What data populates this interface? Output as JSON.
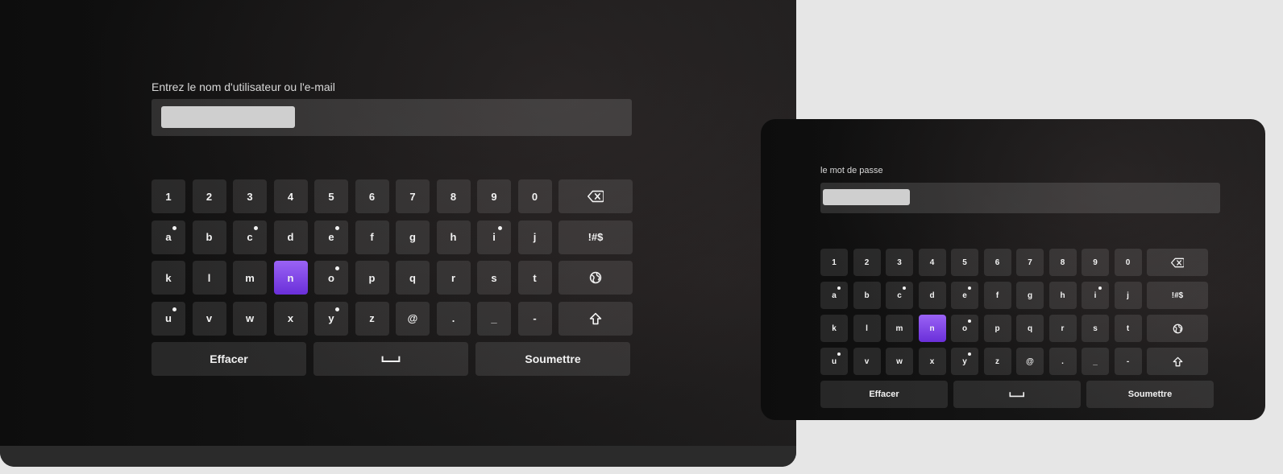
{
  "accent_color": "#7c3aed",
  "screens": [
    {
      "label": "Entrez le nom d'utilisateur ou l'e-mail",
      "keyboard": {
        "rows": [
          [
            {
              "t": "1"
            },
            {
              "t": "2"
            },
            {
              "t": "3"
            },
            {
              "t": "4"
            },
            {
              "t": "5"
            },
            {
              "t": "6"
            },
            {
              "t": "7"
            },
            {
              "t": "8"
            },
            {
              "t": "9"
            },
            {
              "t": "0"
            },
            {
              "icon": "backspace-icon"
            }
          ],
          [
            {
              "t": "a",
              "dot": true
            },
            {
              "t": "b"
            },
            {
              "t": "c",
              "dot": true
            },
            {
              "t": "d"
            },
            {
              "t": "e",
              "dot": true
            },
            {
              "t": "f"
            },
            {
              "t": "g"
            },
            {
              "t": "h"
            },
            {
              "t": "i",
              "dot": true
            },
            {
              "t": "j"
            },
            {
              "t": "!#$"
            }
          ],
          [
            {
              "t": "k"
            },
            {
              "t": "l"
            },
            {
              "t": "m"
            },
            {
              "t": "n",
              "selected": true
            },
            {
              "t": "o",
              "dot": true
            },
            {
              "t": "p"
            },
            {
              "t": "q"
            },
            {
              "t": "r"
            },
            {
              "t": "s"
            },
            {
              "t": "t"
            },
            {
              "icon": "globe-icon"
            }
          ],
          [
            {
              "t": "u",
              "dot": true
            },
            {
              "t": "v"
            },
            {
              "t": "w"
            },
            {
              "t": "x"
            },
            {
              "t": "y",
              "dot": true
            },
            {
              "t": "z"
            },
            {
              "t": "@"
            },
            {
              "t": "."
            },
            {
              "t": "_"
            },
            {
              "t": "-"
            },
            {
              "icon": "shift-icon"
            }
          ]
        ],
        "bottom": [
          {
            "t": "Effacer",
            "name": "clear-button"
          },
          {
            "icon": "space-icon",
            "name": "space-button"
          },
          {
            "t": "Soumettre",
            "name": "submit-button"
          }
        ]
      }
    },
    {
      "label": "le mot de passe",
      "keyboard": {
        "rows": [
          [
            {
              "t": "1"
            },
            {
              "t": "2"
            },
            {
              "t": "3"
            },
            {
              "t": "4"
            },
            {
              "t": "5"
            },
            {
              "t": "6"
            },
            {
              "t": "7"
            },
            {
              "t": "8"
            },
            {
              "t": "9"
            },
            {
              "t": "0"
            },
            {
              "icon": "backspace-icon"
            }
          ],
          [
            {
              "t": "a",
              "dot": true
            },
            {
              "t": "b"
            },
            {
              "t": "c",
              "dot": true
            },
            {
              "t": "d"
            },
            {
              "t": "e",
              "dot": true
            },
            {
              "t": "f"
            },
            {
              "t": "g"
            },
            {
              "t": "h"
            },
            {
              "t": "i",
              "dot": true
            },
            {
              "t": "j"
            },
            {
              "t": "!#$"
            }
          ],
          [
            {
              "t": "k"
            },
            {
              "t": "l"
            },
            {
              "t": "m"
            },
            {
              "t": "n",
              "selected": true
            },
            {
              "t": "o",
              "dot": true
            },
            {
              "t": "p"
            },
            {
              "t": "q"
            },
            {
              "t": "r"
            },
            {
              "t": "s"
            },
            {
              "t": "t"
            },
            {
              "icon": "globe-icon"
            }
          ],
          [
            {
              "t": "u",
              "dot": true
            },
            {
              "t": "v"
            },
            {
              "t": "w"
            },
            {
              "t": "x"
            },
            {
              "t": "y",
              "dot": true
            },
            {
              "t": "z"
            },
            {
              "t": "@"
            },
            {
              "t": "."
            },
            {
              "t": "_"
            },
            {
              "t": "-"
            },
            {
              "icon": "shift-icon"
            }
          ]
        ],
        "bottom": [
          {
            "t": "Effacer",
            "name": "clear-button"
          },
          {
            "icon": "space-icon",
            "name": "space-button"
          },
          {
            "t": "Soumettre",
            "name": "submit-button"
          }
        ]
      }
    }
  ]
}
